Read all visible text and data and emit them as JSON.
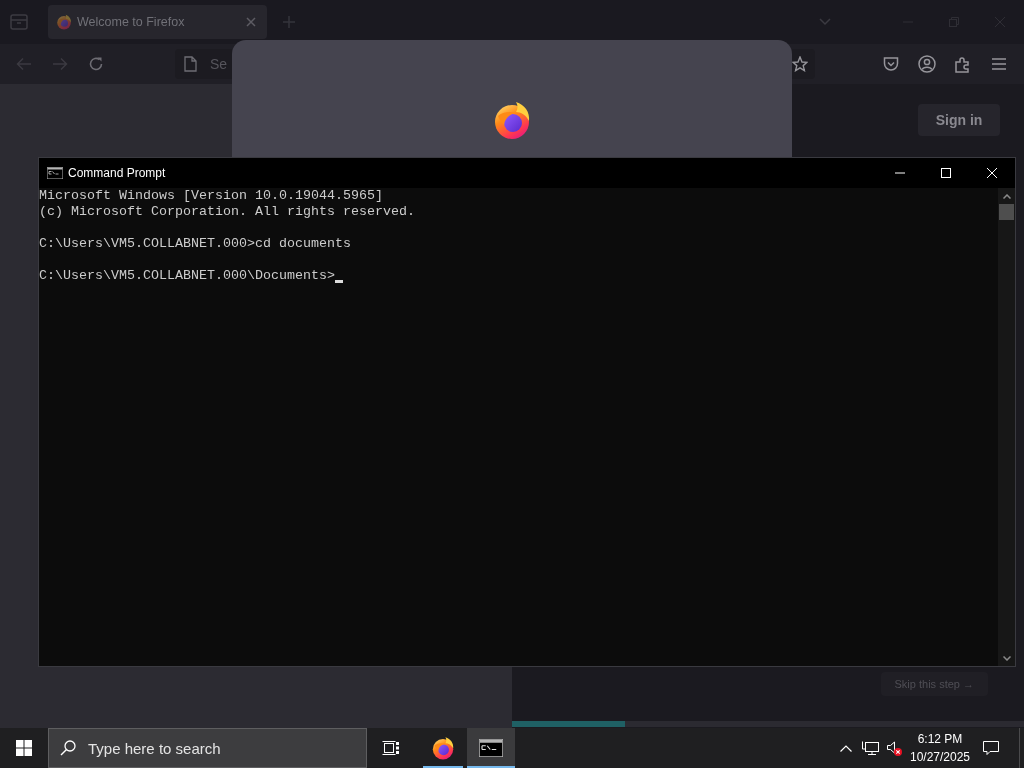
{
  "browser": {
    "tabs": [
      {
        "title": "Welcome to Firefox",
        "selected": true
      }
    ],
    "address_bar": {
      "placeholder": "Se"
    },
    "sign_in_button": {
      "label": "Sign in"
    },
    "skip_button": {
      "label": "Skip this step →"
    },
    "progress": {
      "level": 0.22
    }
  },
  "console_window": {
    "title": "Command Prompt",
    "blocks": [
      [
        "Microsoft Windows [Version 10.0.19044.5965]",
        "(c) Microsoft Corporation. All rights reserved."
      ],
      [
        "C:\\Users\\VM5.COLLABNET.000>cd documents"
      ],
      [
        "C:\\Users\\VM5.COLLABNET.000\\Documents>"
      ]
    ],
    "cursor_visible": true
  },
  "taskbar": {
    "search": {
      "placeholder": "Type here to search"
    },
    "apps": [
      {
        "kind": "browser",
        "selected": false
      },
      {
        "kind": "terminal",
        "selected": true
      }
    ],
    "tray": {
      "volume_muted": true
    },
    "clock": {
      "time": "6:12 PM",
      "date": "10/27/2025"
    }
  }
}
